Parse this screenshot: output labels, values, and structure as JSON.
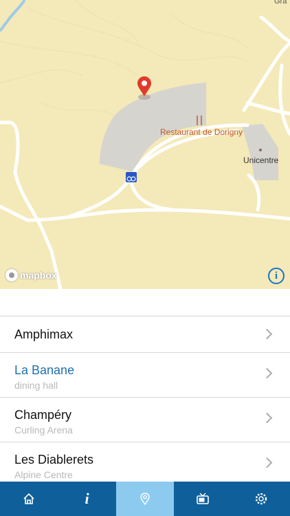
{
  "map": {
    "labels": {
      "restaurant": "Restaurant de Dorigny",
      "unicentre": "Unicentre",
      "top_right_partial": "Gra"
    },
    "attribution": "mapbox",
    "icons": [
      "map-pin-icon",
      "restaurant-icon",
      "bike-icon",
      "info-icon"
    ]
  },
  "places": [
    {
      "title": "Amphimax",
      "subtitle": ""
    },
    {
      "title": "La Banane",
      "subtitle": "dining hall",
      "active": true
    },
    {
      "title": "Champéry",
      "subtitle": "Curling Arena"
    },
    {
      "title": "Les Diablerets",
      "subtitle": "Alpine Centre"
    }
  ],
  "tabbar": {
    "tabs": [
      "home-icon",
      "info-icon",
      "location-icon",
      "tv-icon",
      "gear-icon"
    ],
    "active": "location-icon"
  },
  "colors": {
    "map_bg": "#f4e9b8",
    "building": "#d6d4cf",
    "tabbar": "#0f5f9a",
    "tab_active": "#8dcaf0",
    "link_blue": "#1f6fae",
    "restaurant_label": "#c0562a"
  }
}
